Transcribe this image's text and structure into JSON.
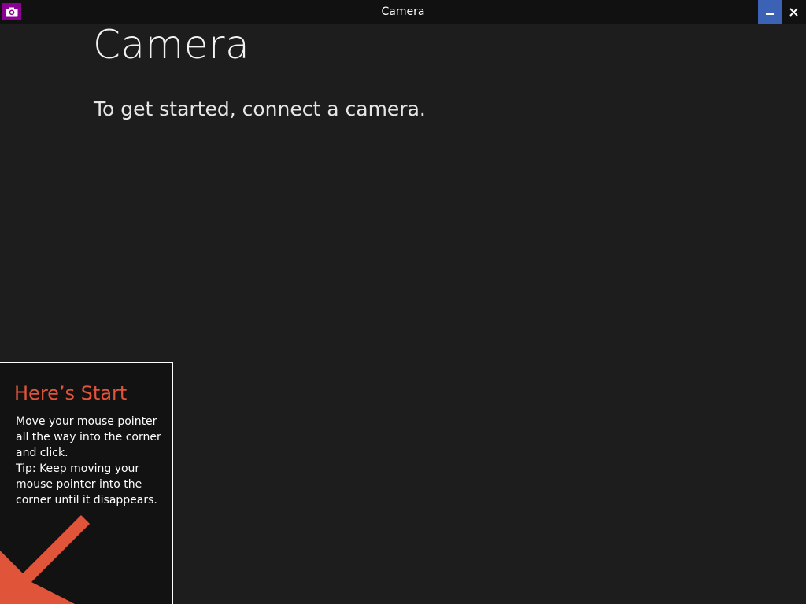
{
  "titlebar": {
    "title": "Camera",
    "app_icon": "camera-icon",
    "minimize_icon": "minimize-icon",
    "close_icon": "close-icon"
  },
  "main": {
    "heading": "Camera",
    "message": "To get started, connect a camera."
  },
  "start_tip": {
    "title": "Here’s Start",
    "lines": [
      "Move your mouse pointer",
      "all the way into the corner",
      "and click.",
      "Tip: Keep moving your",
      "mouse pointer into the",
      "corner until it disappears."
    ],
    "arrow_icon": "arrow-down-left-icon"
  },
  "colors": {
    "background": "#1d1d1d",
    "titlebar": "#111111",
    "app_icon": "#8c0095",
    "minimize_button": "#3c62b5",
    "tip_accent": "#e0553a"
  }
}
